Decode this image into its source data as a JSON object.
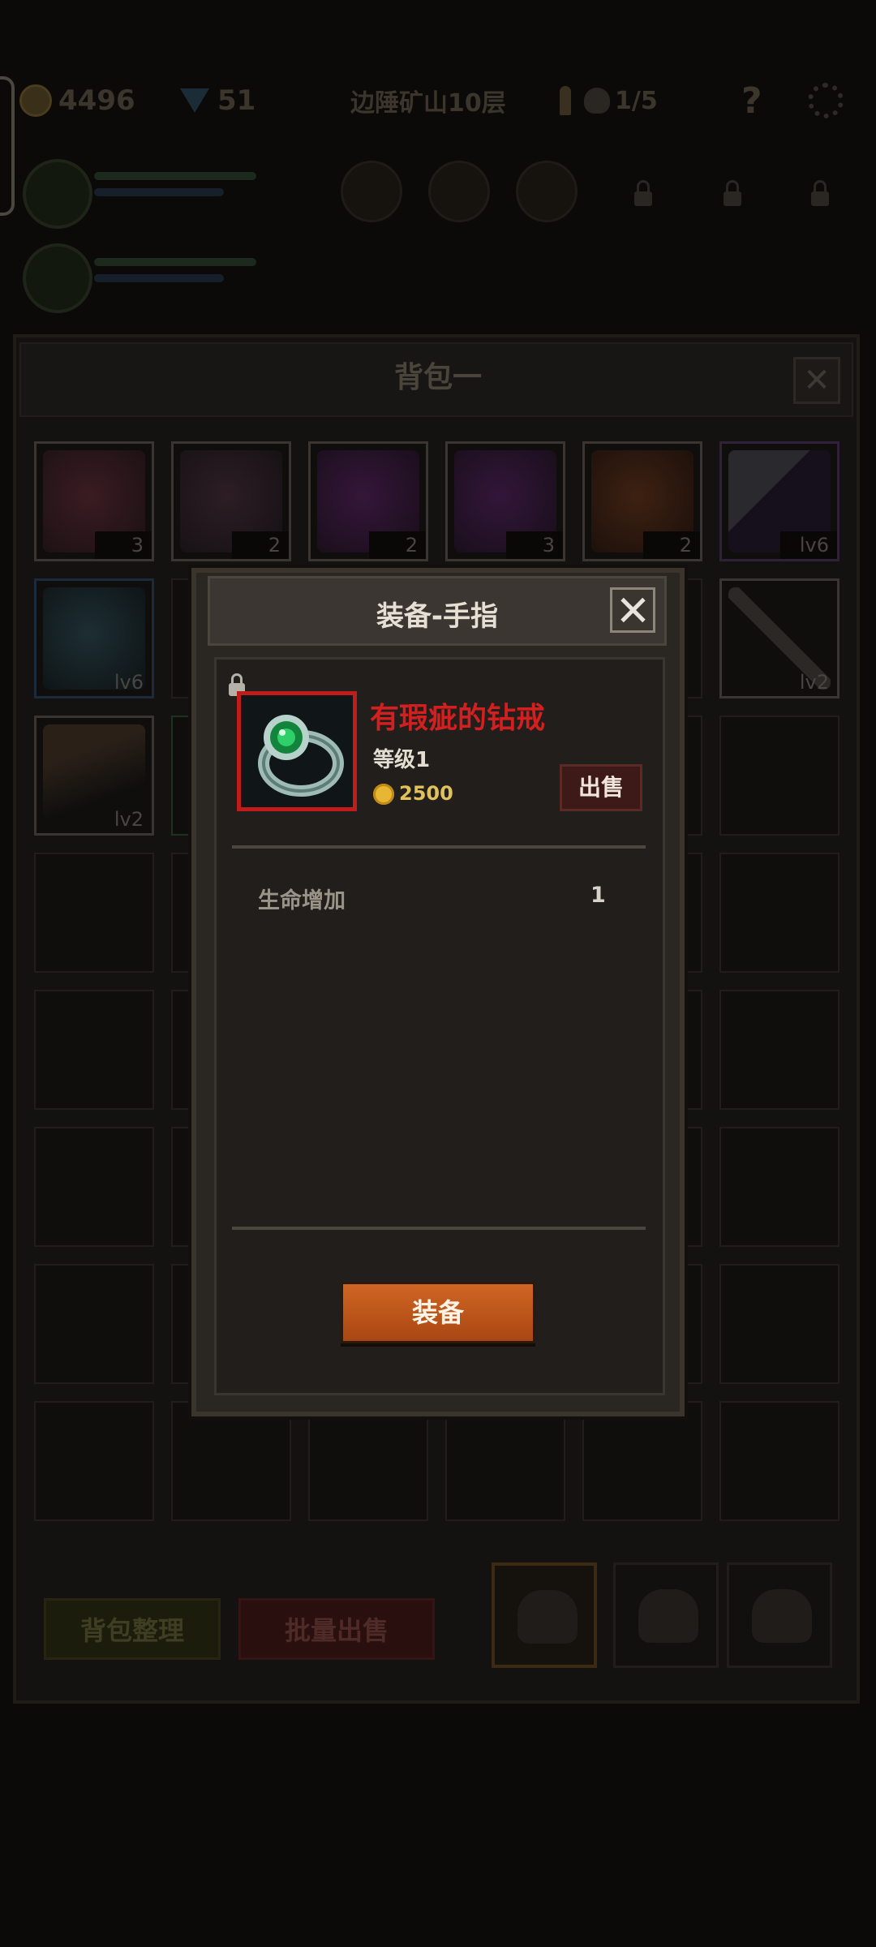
{
  "hud": {
    "gold": "4496",
    "gems": "51",
    "location": "边陲矿山10层",
    "boss_progress": "1/5",
    "help": "?"
  },
  "backpack": {
    "title": "背包一",
    "close": "✕",
    "slots_row1": [
      "3",
      "2",
      "2",
      "3",
      "2",
      "lv6"
    ],
    "slots_row2": [
      "lv6",
      "lv2"
    ],
    "slots_row3": [
      "lv2"
    ],
    "sort_button": "背包整理",
    "bulk_sell_button": "批量出售",
    "colors": {
      "sort_button": "#1c1c0c",
      "bulk_sell_button": "#2a0f0f"
    }
  },
  "modal": {
    "title": "装备-手指",
    "item_name": "有瑕疵的钻戒",
    "level": "等级1",
    "price": "2500",
    "sell_button": "出售",
    "stats": [
      {
        "label": "生命增加",
        "value": "1"
      }
    ],
    "equip_button": "装备",
    "colors": {
      "item_name": "#d21f1f",
      "equip_button": "#c05a1c",
      "rarity_border": "#c01c1c"
    }
  }
}
